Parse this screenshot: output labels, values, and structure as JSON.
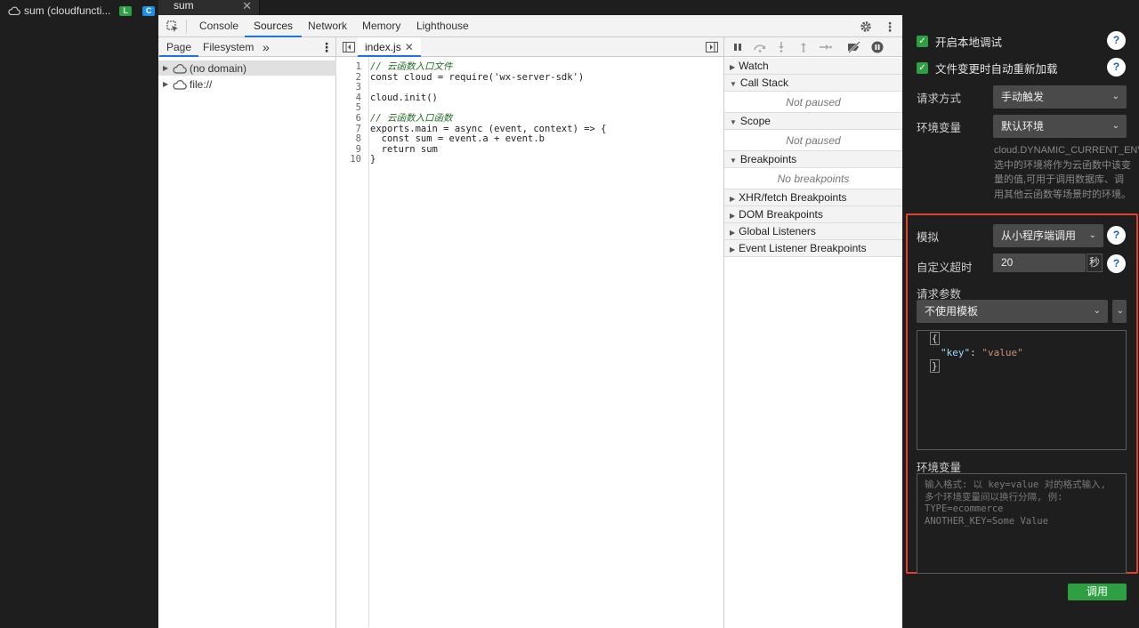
{
  "sidebar": {
    "function_name": "sum (cloudfuncti...",
    "badge_l": "L",
    "badge_c": "C"
  },
  "file_tab": {
    "label": "sum",
    "close": "✕"
  },
  "devtools": {
    "tabs": [
      "Console",
      "Sources",
      "Network",
      "Memory",
      "Lighthouse"
    ],
    "active_tab": "Sources"
  },
  "navigator": {
    "tabs": [
      "Page",
      "Filesystem"
    ],
    "more": "»",
    "items": [
      "(no domain)",
      "file://"
    ]
  },
  "editor": {
    "file_tab": "index.js",
    "close": "✕",
    "lines": [
      "// 云函数入口文件",
      "const cloud = require('wx-server-sdk')",
      "",
      "cloud.init()",
      "",
      "// 云函数入口函数",
      "exports.main = async (event, context) => {",
      "  const sum = event.a + event.b",
      "  return sum",
      "}"
    ],
    "line_numbers": [
      "1",
      "2",
      "3",
      "4",
      "5",
      "6",
      "7",
      "8",
      "9",
      "10"
    ]
  },
  "debugger": {
    "watch": "Watch",
    "call_stack": "Call Stack",
    "call_stack_empty": "Not paused",
    "scope": "Scope",
    "scope_empty": "Not paused",
    "breakpoints": "Breakpoints",
    "breakpoints_empty": "No breakpoints",
    "xhr": "XHR/fetch Breakpoints",
    "dom": "DOM Breakpoints",
    "global": "Global Listeners",
    "event": "Event Listener Breakpoints"
  },
  "panel": {
    "local_debug": "开启本地调试",
    "auto_reload": "文件变更时自动重新加载",
    "request_method_label": "请求方式",
    "request_method_value": "手动触发",
    "env_label": "环境变量",
    "env_value": "默认环境",
    "env_hint": "cloud.DYNAMIC_CURRENT_ENV,选中的环境将作为云函数中该变量的值,可用于调用数据库、调用其他云函数等场景时的环境。",
    "simulate_label": "模拟",
    "simulate_value": "从小程序端调用",
    "timeout_label": "自定义超时",
    "timeout_value": "20",
    "timeout_unit": "秒",
    "params_label": "请求参数",
    "template_value": "不使用模板",
    "json_open": "{",
    "json_key": "\"key\"",
    "json_colon": ": ",
    "json_val": "\"value\"",
    "json_close": "}",
    "env_vars_label": "环境变量",
    "env_vars_placeholder": "输入格式: 以 key=value 对的格式输入, 多个环境变量间以换行分隔, 例:\nTYPE=ecommerce\nANOTHER_KEY=Some Value",
    "invoke_button": "调用",
    "help": "?"
  },
  "colors": {
    "accent": "#1a73e8",
    "green": "#2ea043",
    "highlight": "#e0412f"
  }
}
